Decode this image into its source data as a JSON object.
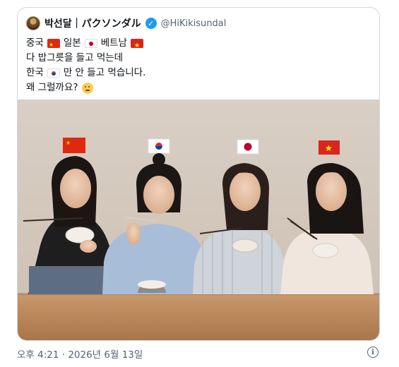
{
  "quoted_tweet": {
    "author": {
      "display_name": "박선달｜パクソンダル",
      "separator": "",
      "verified": true,
      "handle": "@HiKikisundal"
    },
    "text_lines": [
      {
        "segments": [
          {
            "text": "중국"
          },
          {
            "flag": "cn"
          },
          {
            "text": "일본"
          },
          {
            "flag": "jp"
          },
          {
            "text": "베트남"
          },
          {
            "flag": "vn"
          }
        ]
      },
      {
        "segments": [
          {
            "text": "다 밥그릇을 들고 먹는데"
          }
        ]
      },
      {
        "segments": [
          {
            "text": "한국"
          },
          {
            "flag": "kr"
          },
          {
            "text": "만 안 들고 먹습니다."
          }
        ]
      },
      {
        "segments": [
          {
            "text": "왜 그럴까요?"
          },
          {
            "emoji": "thinking"
          }
        ]
      }
    ],
    "image": {
      "type": "photo",
      "subject": "",
      "flags_left_to_right": [
        "cn",
        "kr",
        "jp",
        "vn"
      ]
    }
  },
  "footer": {
    "timestamp": "오후 4:21 · 2026년 6월 13일",
    "info_icon": "info-icon"
  },
  "colors": {
    "text_primary": "#0f1419",
    "text_secondary": "#536471",
    "verified_blue": "#1d9bf0",
    "border": "#cfd9de"
  }
}
